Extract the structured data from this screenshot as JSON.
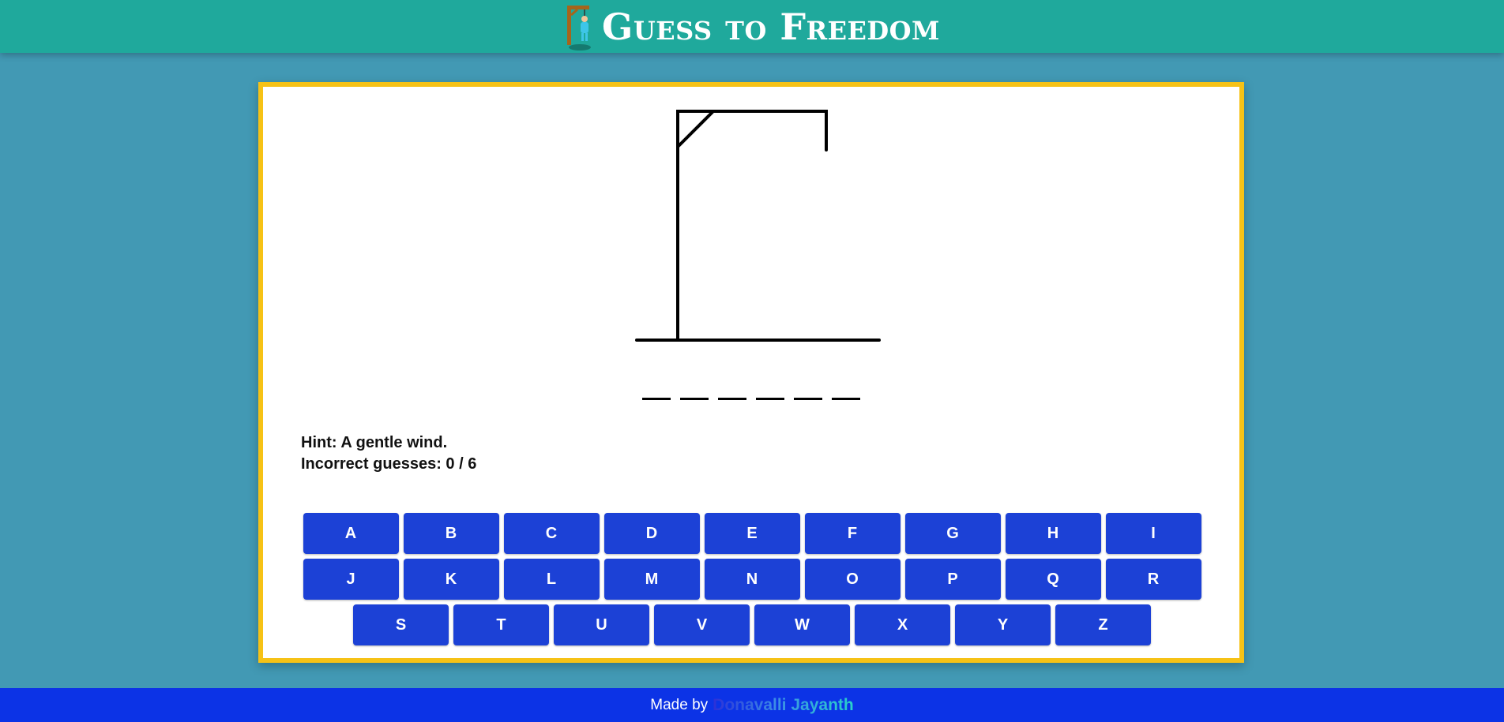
{
  "header": {
    "title": "Guess to Freedom",
    "logo_icon": "hanged-man-logo-icon",
    "background": "#1fa99c"
  },
  "game": {
    "word_slots": [
      "",
      "",
      "",
      "",
      "",
      ""
    ],
    "hint_label": "Hint: A gentle wind.",
    "incorrect_label": "Incorrect guesses: 0 / 6",
    "incorrect_count": 0,
    "max_incorrect": 6
  },
  "keyboard": {
    "rows": [
      [
        "A",
        "B",
        "C",
        "D",
        "E",
        "F",
        "G",
        "H",
        "I"
      ],
      [
        "J",
        "K",
        "L",
        "M",
        "N",
        "O",
        "P",
        "Q",
        "R"
      ],
      [
        "S",
        "T",
        "U",
        "V",
        "W",
        "X",
        "Y",
        "Z"
      ]
    ],
    "key_color": "#1c41d6"
  },
  "footer": {
    "made_by": "Made by",
    "author": "Donavalli Jayanth"
  },
  "colors": {
    "page_background": "#4299b4",
    "card_border": "#f6c216",
    "footer_background": "#0c33e6"
  }
}
